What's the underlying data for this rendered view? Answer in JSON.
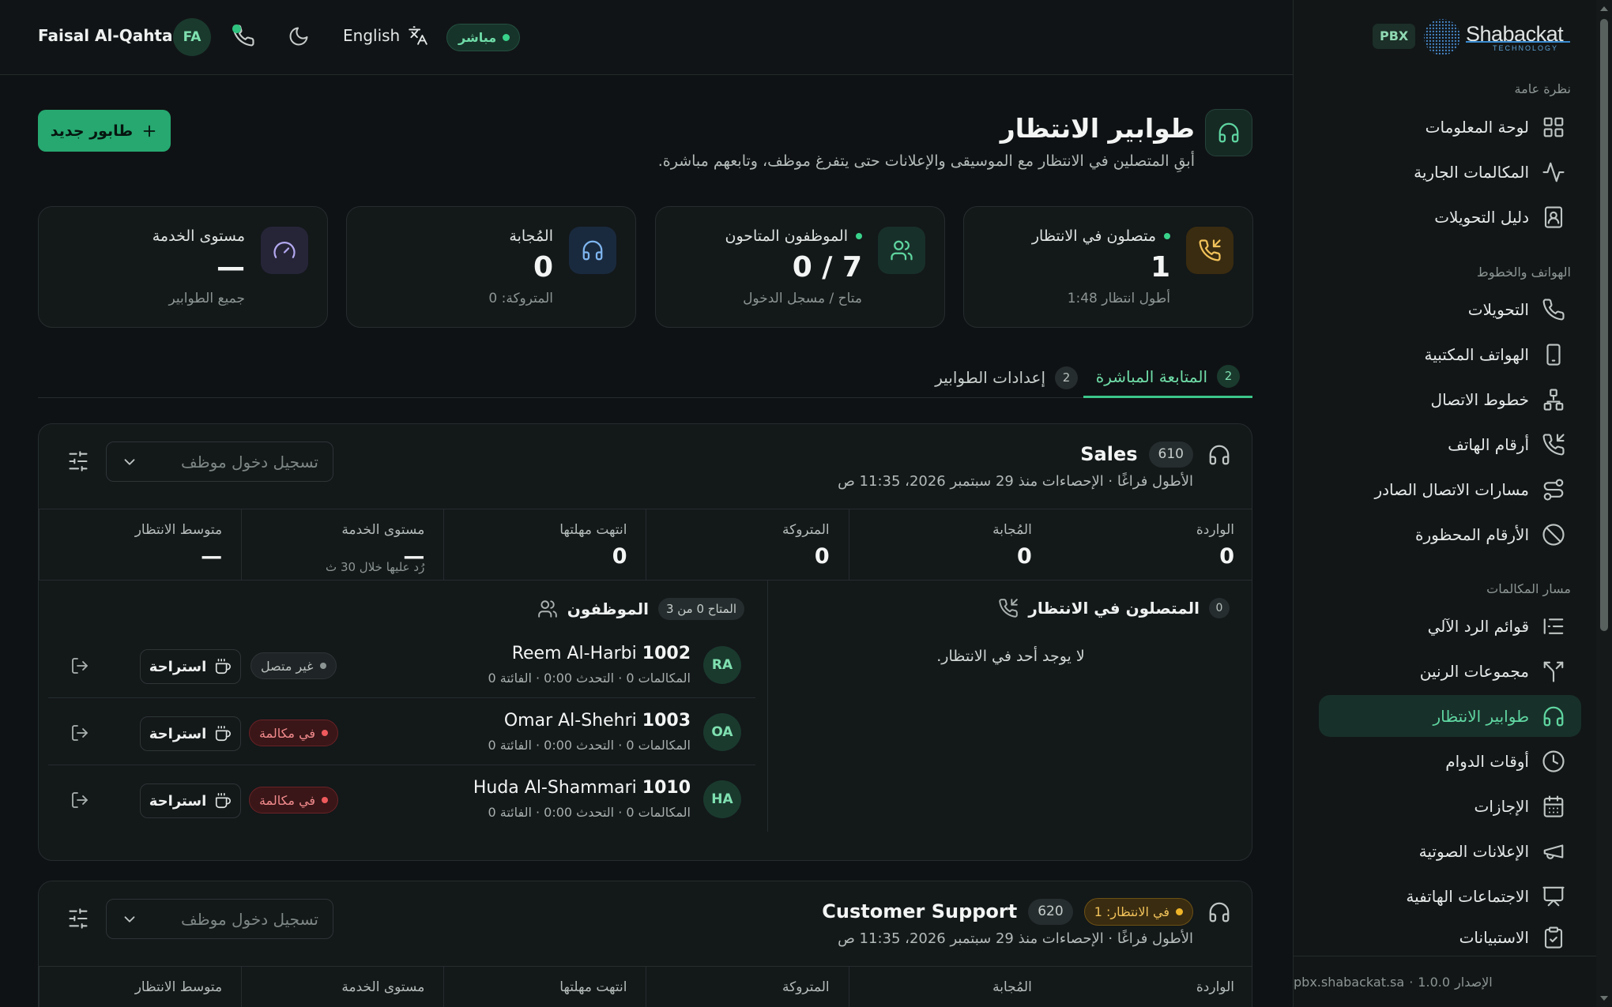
{
  "brand": {
    "name": "Shabackat",
    "sub": "TECHNOLOGY",
    "badge": "PBX"
  },
  "header": {
    "user_name": "Faisal Al-Qahtani",
    "user_initials": "FA",
    "language": "English",
    "live_label": "مباشر"
  },
  "sidebar": {
    "sections": [
      {
        "title": "نظرة عامة"
      },
      {
        "title": "الهواتف والخطوط"
      },
      {
        "title": "مسار المكالمات"
      }
    ],
    "items": [
      {
        "label": "لوحة المعلومات",
        "icon": "dashboard-icon"
      },
      {
        "label": "المكالمات الجارية",
        "icon": "activity-icon"
      },
      {
        "label": "دليل التحويلات",
        "icon": "contact-book-icon"
      },
      {
        "label": "التحويلات",
        "icon": "phone-icon"
      },
      {
        "label": "الهواتف المكتبية",
        "icon": "desk-phone-icon"
      },
      {
        "label": "خطوط الاتصال",
        "icon": "network-icon"
      },
      {
        "label": "أرقام الهاتف",
        "icon": "phone-incoming-icon"
      },
      {
        "label": "مسارات الاتصال الصادر",
        "icon": "route-icon"
      },
      {
        "label": "الأرقام المحظورة",
        "icon": "ban-icon"
      },
      {
        "label": "قوائم الرد الآلي",
        "icon": "ivr-list-icon"
      },
      {
        "label": "مجموعات الرنين",
        "icon": "split-icon"
      },
      {
        "label": "طوابير الانتظار",
        "icon": "headset-icon"
      },
      {
        "label": "أوقات الدوام",
        "icon": "clock-icon"
      },
      {
        "label": "الإجازات",
        "icon": "calendar-icon"
      },
      {
        "label": "الإعلانات الصوتية",
        "icon": "megaphone-icon"
      },
      {
        "label": "الاجتماعات الهاتفية",
        "icon": "presentation-icon"
      },
      {
        "label": "الاستبيانات",
        "icon": "clipboard-icon"
      }
    ],
    "active_index": 11,
    "footer_version_label": "الإصدار",
    "footer_version": "1.0.0",
    "footer_domain": "pbx.shabackat.sa"
  },
  "page": {
    "title": "طوابير الانتظار",
    "subtitle": "أبقِ المتصلين في الانتظار مع الموسيقى والإعلانات حتى يتفرغ موظف، وتابعهم مباشرة.",
    "new_button": "طابور جديد"
  },
  "stats": [
    {
      "label": "متصلون في الانتظار",
      "value": "1",
      "note": "أطول انتظار 1:48",
      "live": true
    },
    {
      "label": "الموظفون المتاحون",
      "value": "0 / 7",
      "note": "متاح / مسجل الدخول",
      "live": true
    },
    {
      "label": "المُجابة",
      "value": "0",
      "note": "المتروكة: 0",
      "live": false
    },
    {
      "label": "مستوى الخدمة",
      "value": "—",
      "note": "جميع الطوابير",
      "live": false
    }
  ],
  "tabs": [
    {
      "label": "المتابعة المباشرة",
      "count": "2"
    },
    {
      "label": "إعدادات الطوابير",
      "count": "2"
    }
  ],
  "queue_columns": [
    "الواردة",
    "المُجابة",
    "المتروكة",
    "انتهت مهلتها",
    "مستوى الخدمة",
    "متوسط الانتظار"
  ],
  "queues": [
    {
      "name": "Sales",
      "extension": "610",
      "meta": "الأطول فراغًا · الإحصاءات منذ 29 سبتمبر 2026، 11:35 ص",
      "agent_select_placeholder": "تسجيل دخول موظف",
      "stats": [
        "0",
        "0",
        "0",
        "0",
        "—",
        "—"
      ],
      "service_level_note": "رُد عليها خلال 30 ث",
      "callers_title": "المتصلون في الانتظار",
      "callers_count": "0",
      "callers_empty": "لا يوجد أحد في الانتظار.",
      "agents_title": "الموظفون",
      "agents_available": "المتاح 0 من 3",
      "agents": [
        {
          "initials": "RA",
          "name": "Reem Al-Harbi",
          "ext": "1002",
          "meta": "المكالمات 0 · التحدث 0:00 · الفائتة 0",
          "status": "غير متصل",
          "status_kind": "off",
          "break_label": "استراحة"
        },
        {
          "initials": "OA",
          "name": "Omar Al-Shehri",
          "ext": "1003",
          "meta": "المكالمات 0 · التحدث 0:00 · الفائتة 0",
          "status": "في مكالمة",
          "status_kind": "busy",
          "break_label": "استراحة"
        },
        {
          "initials": "HA",
          "name": "Huda Al-Shammari",
          "ext": "1010",
          "meta": "المكالمات 0 · التحدث 0:00 · الفائتة 0",
          "status": "في مكالمة",
          "status_kind": "busy",
          "break_label": "استراحة"
        }
      ]
    },
    {
      "name": "Customer Support",
      "extension": "620",
      "waiting_badge": "في الانتظار: 1",
      "meta": "الأطول فراغًا · الإحصاءات منذ 29 سبتمبر 2026، 11:35 ص",
      "agent_select_placeholder": "تسجيل دخول موظف"
    }
  ],
  "colors": {
    "accent": "#26a870",
    "accent_text": "#5fd6a1",
    "background": "#0f1214",
    "card": "#131819",
    "busy": "#ef5a5d",
    "waiting": "#f0b429"
  }
}
